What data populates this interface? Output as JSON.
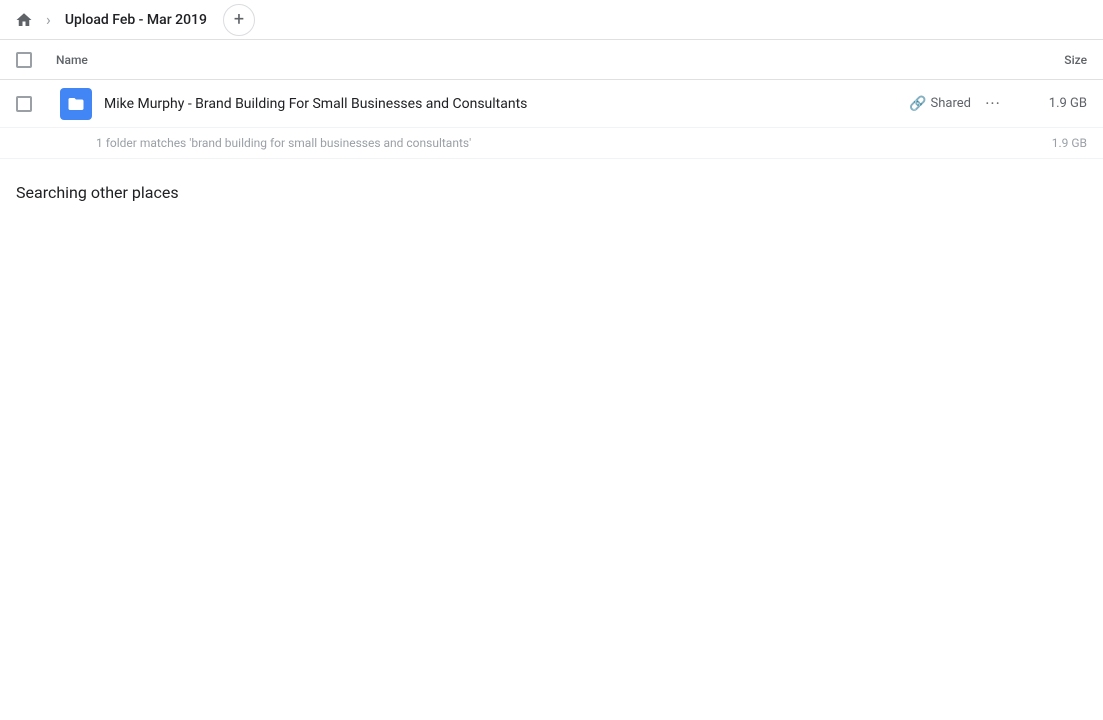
{
  "topbar": {
    "home_icon": "home",
    "breadcrumb_title": "Upload Feb - Mar 2019",
    "add_button_label": "+"
  },
  "column_headers": {
    "name_label": "Name",
    "size_label": "Size"
  },
  "file_row": {
    "name": "Mike Murphy - Brand Building For Small Businesses and Consultants",
    "shared_label": "Shared",
    "more_label": "···",
    "size": "1.9 GB"
  },
  "match_info": {
    "text": "1 folder matches 'brand building for small businesses and consultants'",
    "size": "1.9 GB"
  },
  "searching_section": {
    "title": "Searching other places"
  }
}
